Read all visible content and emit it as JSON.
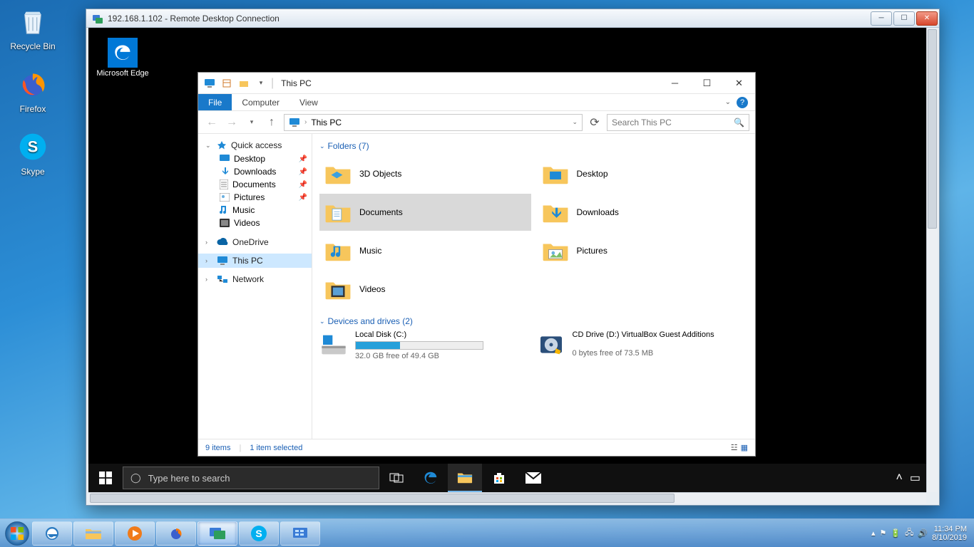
{
  "host": {
    "desktop_icons": [
      {
        "name": "recycle-bin",
        "label": "Recycle Bin"
      },
      {
        "name": "firefox",
        "label": "Firefox"
      },
      {
        "name": "skype",
        "label": "Skype"
      }
    ],
    "taskbar_time": "11:34 PM",
    "taskbar_date": "8/10/2019"
  },
  "rdc": {
    "title": "192.168.1.102 - Remote Desktop Connection"
  },
  "remote": {
    "desktop_icons": [
      {
        "name": "edge",
        "label": "Microsoft Edge"
      }
    ],
    "search_placeholder": "Type here to search"
  },
  "explorer": {
    "title": "This PC",
    "ribbon": {
      "file": "File",
      "computer": "Computer",
      "view": "View"
    },
    "address": {
      "location": "This PC"
    },
    "search_placeholder": "Search This PC",
    "navpane": {
      "quick_access": "Quick access",
      "quick_items": [
        {
          "label": "Desktop"
        },
        {
          "label": "Downloads"
        },
        {
          "label": "Documents"
        },
        {
          "label": "Pictures"
        },
        {
          "label": "Music"
        },
        {
          "label": "Videos"
        }
      ],
      "onedrive": "OneDrive",
      "thispc": "This PC",
      "network": "Network"
    },
    "groups": {
      "folders_header": "Folders (7)",
      "devices_header": "Devices and drives (2)"
    },
    "folders": [
      {
        "label": "3D Objects"
      },
      {
        "label": "Desktop"
      },
      {
        "label": "Documents",
        "selected": true
      },
      {
        "label": "Downloads"
      },
      {
        "label": "Music"
      },
      {
        "label": "Pictures"
      },
      {
        "label": "Videos"
      }
    ],
    "drives": [
      {
        "label": "Local Disk (C:)",
        "free": "32.0 GB free of 49.4 GB",
        "fill_pct": 35
      },
      {
        "label": "CD Drive (D:) VirtualBox Guest Additions",
        "free": "0 bytes free of 73.5 MB",
        "fill_pct": 0
      }
    ],
    "status": {
      "items": "9 items",
      "selected": "1 item selected"
    }
  }
}
